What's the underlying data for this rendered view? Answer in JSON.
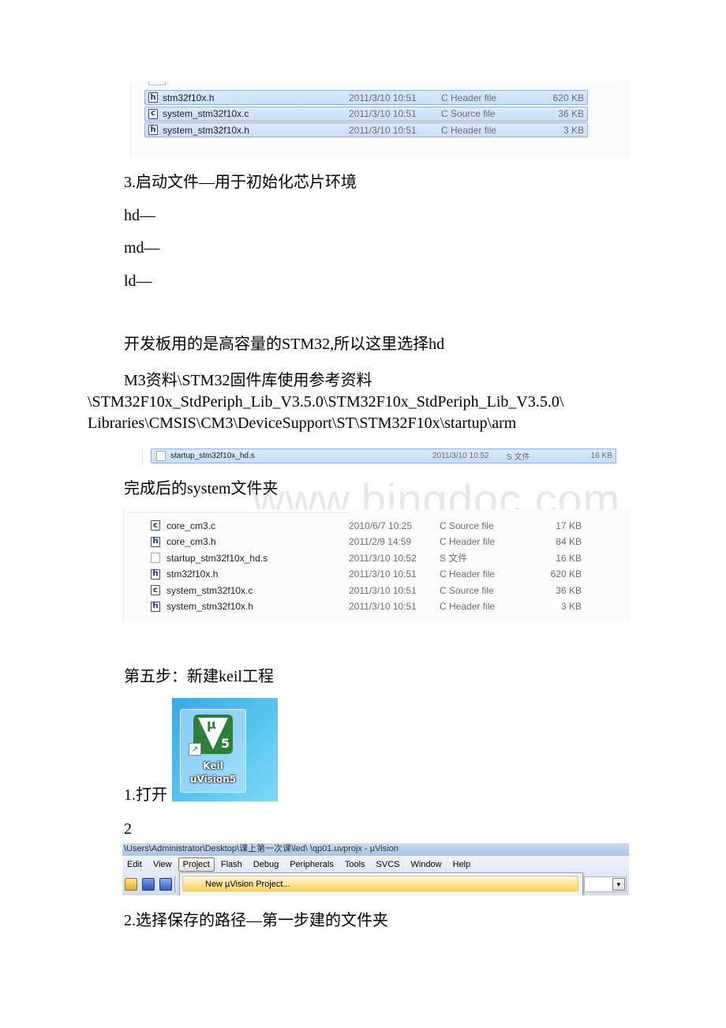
{
  "screenshot1": {
    "files": [
      {
        "icon": "h",
        "name": "stm32f10x.h",
        "date": "2011/3/10 10:51",
        "type": "C Header file",
        "size": "620 KB"
      },
      {
        "icon": "c",
        "name": "system_stm32f10x.c",
        "date": "2011/3/10 10:51",
        "type": "C Source file",
        "size": "36 KB"
      },
      {
        "icon": "h",
        "name": "system_stm32f10x.h",
        "date": "2011/3/10 10:51",
        "type": "C Header file",
        "size": "3 KB"
      }
    ]
  },
  "text": {
    "startup_heading": "3.启动文件—用于初始化芯片环境",
    "hd": "hd—",
    "md": "md—",
    "ld": "ld—",
    "choice": "开发板用的是高容量的STM32,所以这里选择hd",
    "path_line1": "M3资料\\STM32固件库使用参考资料",
    "path_line2": "\\STM32F10x_StdPeriph_Lib_V3.5.0\\STM32F10x_StdPeriph_Lib_V3.5.0\\",
    "path_line3": "Libraries\\CMSIS\\CM3\\DeviceSupport\\ST\\STM32F10x\\startup\\arm",
    "system_folder": "完成后的system文件夹",
    "step5": "第五步：新建keil工程",
    "open": "1.打开",
    "two": "2",
    "choose_path": "2.选择保存的路径—第一步建的文件夹"
  },
  "screenshot2": {
    "file": {
      "name": "startup_stm32f10x_hd.s",
      "date": "2011/3/10 10:52",
      "type": "S 文件",
      "size": "16 KB"
    }
  },
  "screenshot3": {
    "files": [
      {
        "icon": "c",
        "name": "core_cm3.c",
        "date": "2010/6/7 10:25",
        "type": "C Source file",
        "size": "17 KB"
      },
      {
        "icon": "h",
        "name": "core_cm3.h",
        "date": "2011/2/9 14:59",
        "type": "C Header file",
        "size": "84 KB"
      },
      {
        "icon": "blank",
        "name": "startup_stm32f10x_hd.s",
        "date": "2011/3/10 10:52",
        "type": "S 文件",
        "size": "16 KB"
      },
      {
        "icon": "h",
        "name": "stm32f10x.h",
        "date": "2011/3/10 10:51",
        "type": "C Header file",
        "size": "620 KB"
      },
      {
        "icon": "c",
        "name": "system_stm32f10x.c",
        "date": "2011/3/10 10:51",
        "type": "C Source file",
        "size": "36 KB"
      },
      {
        "icon": "h",
        "name": "system_stm32f10x.h",
        "date": "2011/3/10 10:51",
        "type": "C Header file",
        "size": "3 KB"
      }
    ]
  },
  "keil_icon": {
    "mu": "μ",
    "version": "5",
    "label_line1": "Keil",
    "label_line2": "uVision5",
    "shortcut_arrow": "↗"
  },
  "uvision": {
    "title": "\\Users\\Administrator\\Desktop\\课上第一次课\\led\\ \\qp01.uvprojx - µVision",
    "menu": [
      "Edit",
      "View",
      "Project",
      "Flash",
      "Debug",
      "Peripherals",
      "Tools",
      "SVCS",
      "Window",
      "Help"
    ],
    "active_menu": "Project",
    "dropdown_item": "New µVision Project...",
    "combo_arrow": "▼"
  },
  "watermark": "www.bingdoc.com"
}
